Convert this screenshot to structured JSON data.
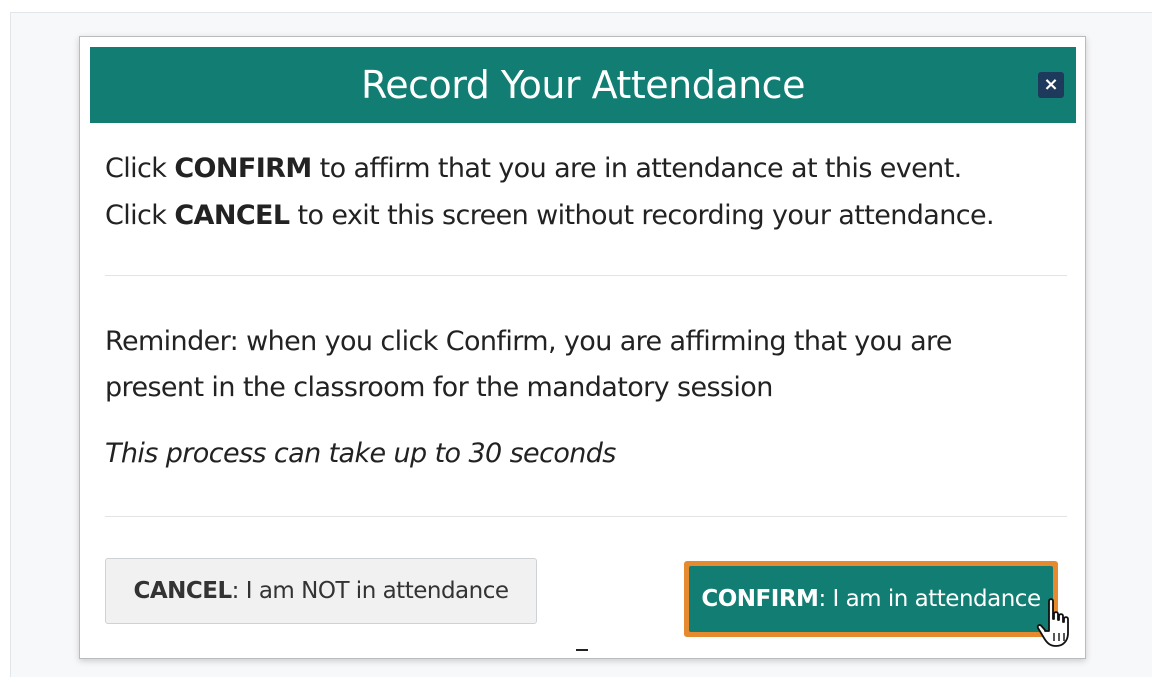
{
  "modal": {
    "title": "Record Your Attendance",
    "close_label": "×",
    "instructions": {
      "line1": {
        "prefix": "Click ",
        "keyword": "CONFIRM",
        "suffix": " to affirm that you are in attendance at this event."
      },
      "line2": {
        "prefix": "Click ",
        "keyword": "CANCEL",
        "suffix": " to exit this screen without recording your attendance."
      }
    },
    "reminder": "Reminder: when you click Confirm, you are affirming that you are present in the classroom for the mandatory session",
    "process_note": "This process can take up to 30 seconds",
    "buttons": {
      "cancel": {
        "keyword": "CANCEL",
        "rest": ": I am NOT in attendance"
      },
      "confirm": {
        "keyword": "CONFIRM",
        "rest": ": I am in attendance"
      }
    }
  },
  "colors": {
    "header_bg": "#127d72",
    "confirm_bg": "#127d72",
    "confirm_focus_outline": "#e58a2e",
    "close_bg": "#1d3a5c",
    "cancel_bg": "#f1f1f1"
  },
  "icons": {
    "close": "close-icon",
    "cursor": "hand-pointer-icon"
  }
}
